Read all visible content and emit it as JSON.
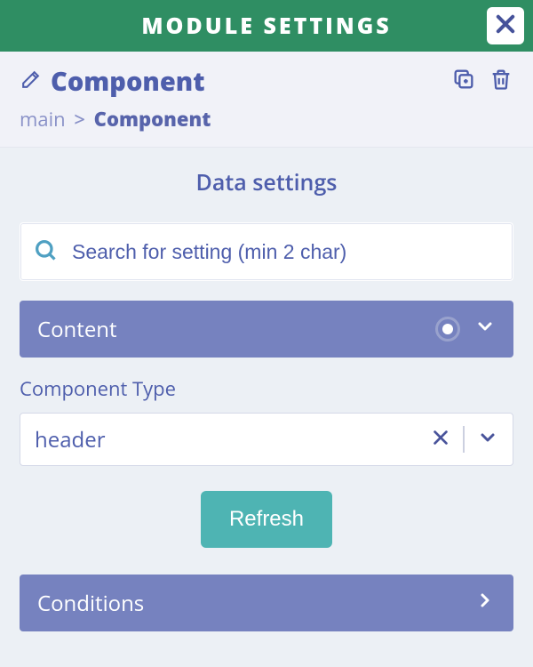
{
  "header": {
    "title": "MODULE SETTINGS"
  },
  "subheader": {
    "title": "Component",
    "breadcrumb": {
      "root": "main",
      "sep": ">",
      "current": "Component"
    }
  },
  "section_title": "Data settings",
  "search": {
    "placeholder": "Search for setting (min 2 char)"
  },
  "accordion": {
    "content": {
      "label": "Content"
    },
    "conditions": {
      "label": "Conditions"
    }
  },
  "field": {
    "component_type": {
      "label": "Component Type",
      "value": "header"
    }
  },
  "buttons": {
    "refresh": "Refresh"
  }
}
